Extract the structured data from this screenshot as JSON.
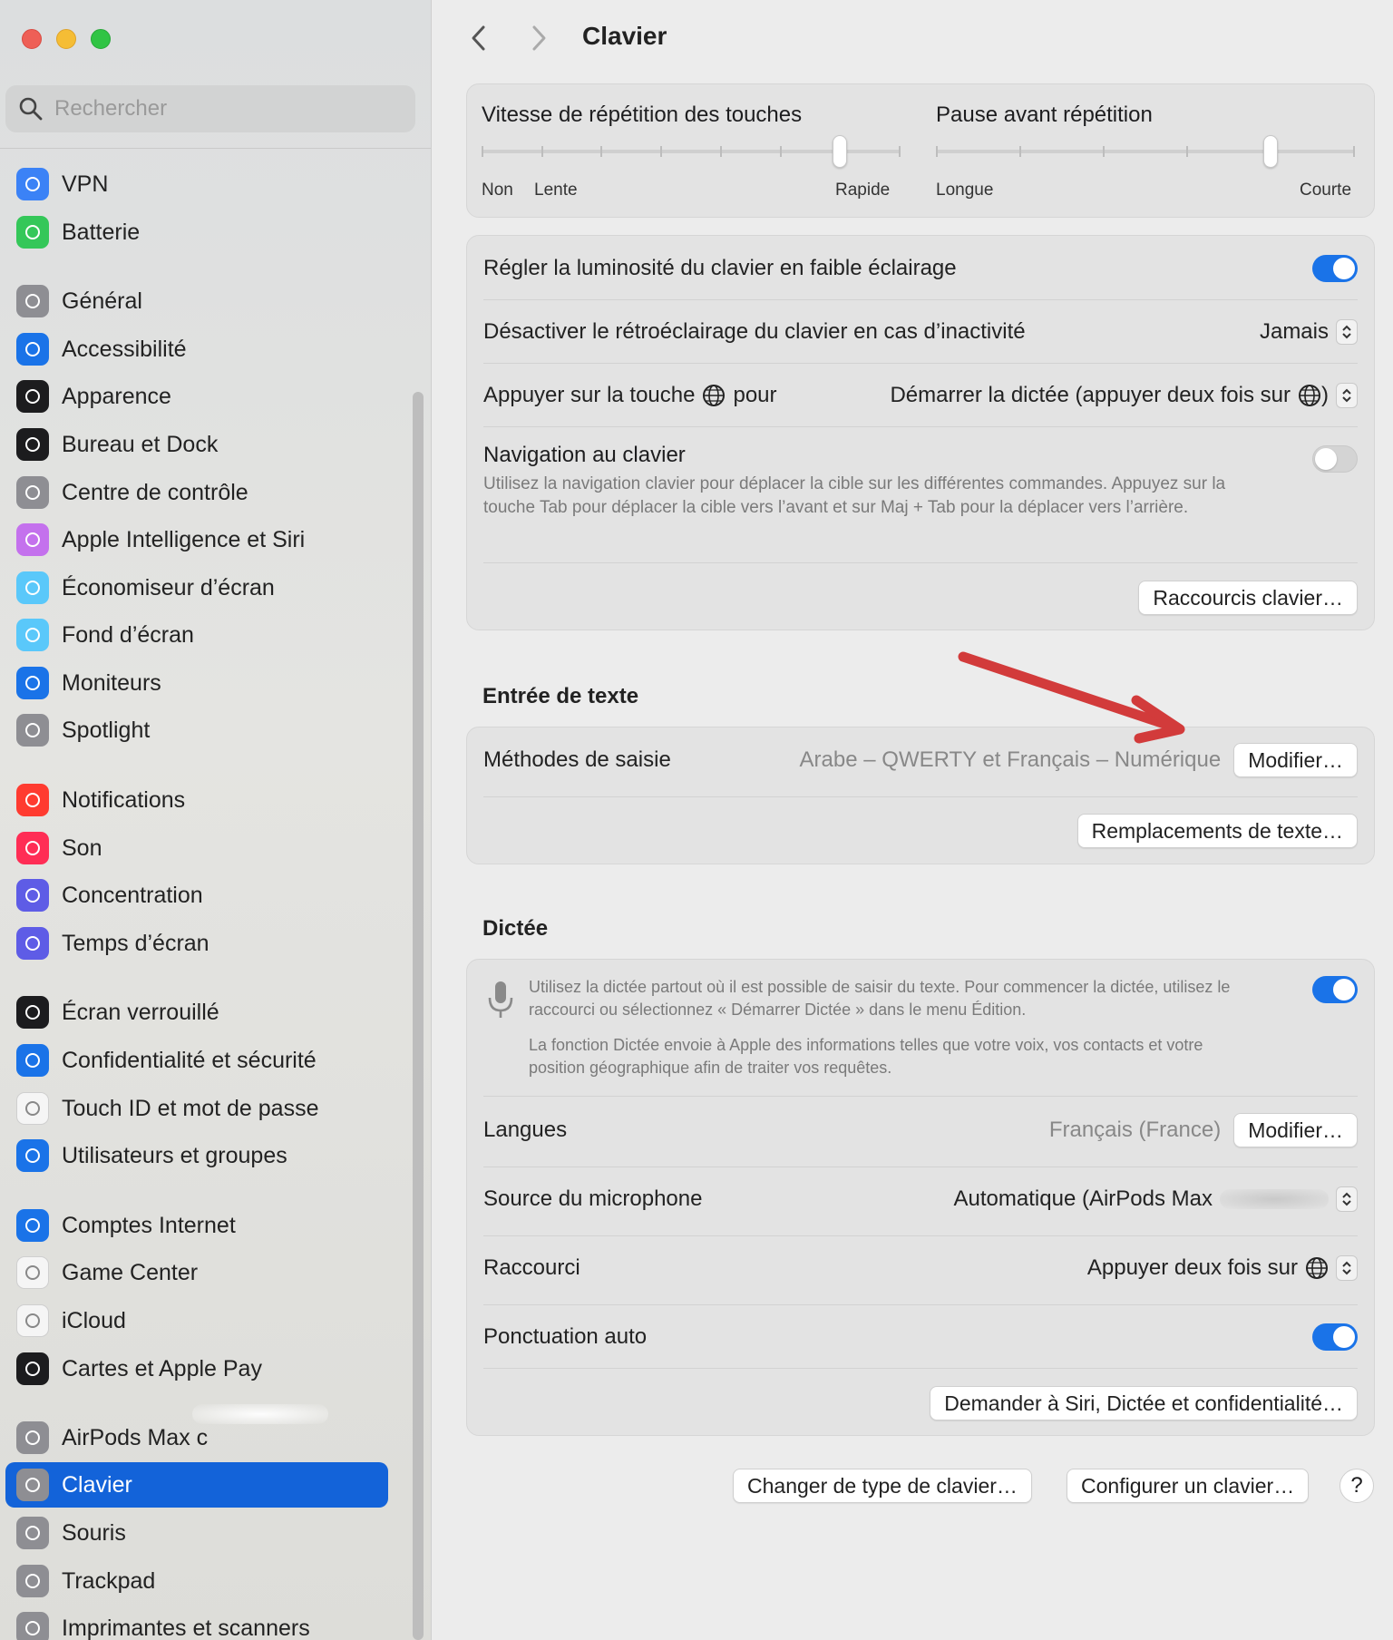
{
  "sidebar": {
    "search_placeholder": "Rechercher",
    "items": [
      {
        "label": "VPN",
        "icon": "vpn-icon",
        "color": "#3b82f6"
      },
      {
        "label": "Batterie",
        "icon": "battery-icon",
        "color": "#34c759"
      },
      {
        "label": "Général",
        "icon": "gear-icon",
        "color": "#8e8e93"
      },
      {
        "label": "Accessibilité",
        "icon": "accessibility-icon",
        "color": "#1a73e8"
      },
      {
        "label": "Apparence",
        "icon": "appearance-icon",
        "color": "#1c1c1e"
      },
      {
        "label": "Bureau et Dock",
        "icon": "dock-icon",
        "color": "#1c1c1e"
      },
      {
        "label": "Centre de contrôle",
        "icon": "control-center-icon",
        "color": "#8e8e93"
      },
      {
        "label": "Apple Intelligence et Siri",
        "icon": "siri-icon",
        "color": "#c471ed"
      },
      {
        "label": "Économiseur d’écran",
        "icon": "screensaver-icon",
        "color": "#5ac8fa"
      },
      {
        "label": "Fond d’écran",
        "icon": "wallpaper-icon",
        "color": "#5ac8fa"
      },
      {
        "label": "Moniteurs",
        "icon": "display-icon",
        "color": "#1a73e8"
      },
      {
        "label": "Spotlight",
        "icon": "spotlight-icon",
        "color": "#8e8e93"
      },
      {
        "label": "Notifications",
        "icon": "bell-icon",
        "color": "#ff3b30"
      },
      {
        "label": "Son",
        "icon": "speaker-icon",
        "color": "#ff2d55"
      },
      {
        "label": "Concentration",
        "icon": "moon-icon",
        "color": "#5e5ce6"
      },
      {
        "label": "Temps d’écran",
        "icon": "hourglass-icon",
        "color": "#5e5ce6"
      },
      {
        "label": "Écran verrouillé",
        "icon": "lock-icon",
        "color": "#1c1c1e"
      },
      {
        "label": "Confidentialité et sécurité",
        "icon": "hand-icon",
        "color": "#1a73e8"
      },
      {
        "label": "Touch ID et mot de passe",
        "icon": "fingerprint-icon",
        "color": "#f5f5f5"
      },
      {
        "label": "Utilisateurs et groupes",
        "icon": "users-icon",
        "color": "#1a73e8"
      },
      {
        "label": "Comptes Internet",
        "icon": "at-icon",
        "color": "#1a73e8"
      },
      {
        "label": "Game Center",
        "icon": "game-center-icon",
        "color": "#f5f5f5"
      },
      {
        "label": "iCloud",
        "icon": "cloud-icon",
        "color": "#f5f5f5"
      },
      {
        "label": "Cartes et Apple Pay",
        "icon": "wallet-icon",
        "color": "#1c1c1e"
      },
      {
        "label": "AirPods Max c",
        "icon": "headphones-icon",
        "color": "#8e8e93"
      },
      {
        "label": "Clavier",
        "icon": "keyboard-icon",
        "color": "#8e8e93"
      },
      {
        "label": "Souris",
        "icon": "mouse-icon",
        "color": "#8e8e93"
      },
      {
        "label": "Trackpad",
        "icon": "trackpad-icon",
        "color": "#8e8e93"
      },
      {
        "label": "Imprimantes et scanners",
        "icon": "printer-icon",
        "color": "#8e8e93"
      }
    ]
  },
  "header": {
    "title": "Clavier"
  },
  "repeat": {
    "speed_title": "Vitesse de répétition des touches",
    "speed_labels": [
      "Non",
      "Lente",
      "Rapide"
    ],
    "speed_value": 6,
    "speed_steps": 8,
    "delay_title": "Pause avant répétition",
    "delay_labels": [
      "Longue",
      "Courte"
    ],
    "delay_value": 4,
    "delay_steps": 6
  },
  "settings": {
    "brightness_label": "Régler la luminosité du clavier en faible éclairage",
    "backlight_label": "Désactiver le rétroéclairage du clavier en cas d’inactivité",
    "backlight_value": "Jamais",
    "globe_label_pre": "Appuyer sur la touche",
    "globe_label_post": "pour",
    "globe_value": "Démarrer la dictée (appuyer deux fois sur",
    "globe_value_end": ")",
    "nav_label": "Navigation au clavier",
    "nav_desc": "Utilisez la navigation clavier pour déplacer la cible sur les différentes commandes. Appuyez sur la touche Tab pour déplacer la cible vers l’avant et sur Maj + Tab pour la déplacer vers l’arrière.",
    "shortcuts_button": "Raccourcis clavier…"
  },
  "text_input": {
    "section": "Entrée de texte",
    "methods_label": "Méthodes de saisie",
    "methods_value": "Arabe – QWERTY et Français – Numérique",
    "modify_button": "Modifier…",
    "replacements_button": "Remplacements de texte…"
  },
  "dictation": {
    "section": "Dictée",
    "desc1": "Utilisez la dictée partout où il est possible de saisir du texte. Pour commencer la dictée, utilisez le raccourci ou sélectionnez « Démarrer Dictée » dans le menu Édition.",
    "desc2": "La fonction Dictée envoie à Apple des informations telles que votre voix, vos contacts et votre position géographique afin de traiter vos requêtes.",
    "languages_label": "Langues",
    "languages_value": "Français (France)",
    "modify_button": "Modifier…",
    "mic_label": "Source du microphone",
    "mic_value": "Automatique (AirPods Max",
    "shortcut_label": "Raccourci",
    "shortcut_value": "Appuyer deux fois sur",
    "punct_label": "Ponctuation auto",
    "siri_button": "Demander à Siri, Dictée et confidentialité…"
  },
  "footer": {
    "change_type_button": "Changer de type de clavier…",
    "configure_button": "Configurer un clavier…",
    "help_button": "?"
  }
}
